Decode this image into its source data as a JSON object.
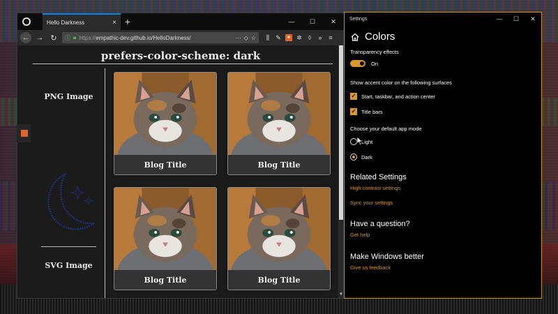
{
  "browser": {
    "tab_title": "Hello Darkness",
    "tab_close_glyph": "×",
    "new_tab_glyph": "+",
    "window_controls": [
      "—",
      "☐",
      "✕"
    ],
    "url_scheme": "https://",
    "url_rest": "empathic-dev.github.io/HelloDarkness/",
    "url_more": "···"
  },
  "page": {
    "title": "prefers-color-scheme: dark",
    "png_label": "PNG Image",
    "svg_label": "SVG Image",
    "cards": [
      {
        "caption": "Blog Title"
      },
      {
        "caption": "Blog Title"
      },
      {
        "caption": "Blog Title"
      },
      {
        "caption": "Blog Title"
      }
    ]
  },
  "settings": {
    "window_title": "Settings",
    "window_controls": [
      "—",
      "☐",
      "✕"
    ],
    "heading": "Colors",
    "transparency_label": "Transparency effects",
    "transparency_state": "On",
    "accent_label": "Show accent color on the following surfaces",
    "accent_opt1": "Start, taskbar, and action center",
    "accent_opt2": "Title bars",
    "mode_label": "Choose your default app mode",
    "mode_light": "Light",
    "mode_dark": "Dark",
    "related_heading": "Related Settings",
    "related_link1": "High contrast settings",
    "related_link2": "Sync your settings",
    "question_heading": "Have a question?",
    "question_link": "Get help",
    "improve_heading": "Make Windows better",
    "improve_link": "Give us feedback"
  },
  "colors": {
    "accent": "#d79a2a",
    "link_blue": "#0a84ff",
    "extension_orange": "#e0622c"
  }
}
